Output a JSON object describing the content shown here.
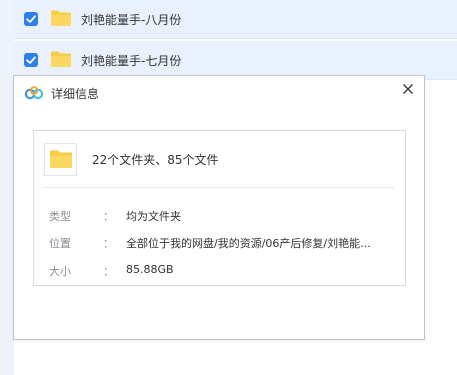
{
  "file_list": {
    "rows": [
      {
        "name": "刘艳能量手-八月份",
        "checked": true
      },
      {
        "name": "刘艳能量手-七月份",
        "checked": true
      }
    ]
  },
  "dialog": {
    "title": "详细信息",
    "close_icon": "close-icon",
    "summary": "22个文件夹、85个文件",
    "fields": [
      {
        "label": "类型",
        "value": "均为文件夹"
      },
      {
        "label": "位置",
        "value": "全部位于我的网盘/我的资源/06产后修复/刘艳能..."
      },
      {
        "label": "大小",
        "value": "85.88GB"
      }
    ],
    "colon": "："
  },
  "colors": {
    "accent": "#2b7ff0",
    "row_bg": "#e8f1fd",
    "folder": "#f8cd42"
  }
}
